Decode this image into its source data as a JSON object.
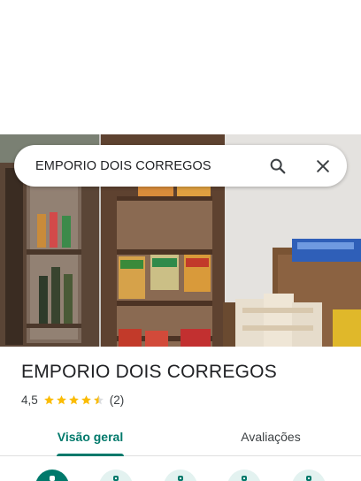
{
  "search": {
    "query": "EMPORIO DOIS CORREGOS"
  },
  "place": {
    "name": "EMPORIO DOIS CORREGOS",
    "rating": "4,5",
    "rating_value": 4.5,
    "reviews": "(2)"
  },
  "tabs": [
    {
      "label": "Visão geral",
      "active": true
    },
    {
      "label": "Avaliações",
      "active": false
    }
  ],
  "icons": {
    "search": "search-icon",
    "close": "close-icon",
    "star": "star-icon"
  },
  "colors": {
    "accent": "#00796b",
    "star": "#fbbc04",
    "star_empty": "#dadce0",
    "text": "#202124"
  }
}
